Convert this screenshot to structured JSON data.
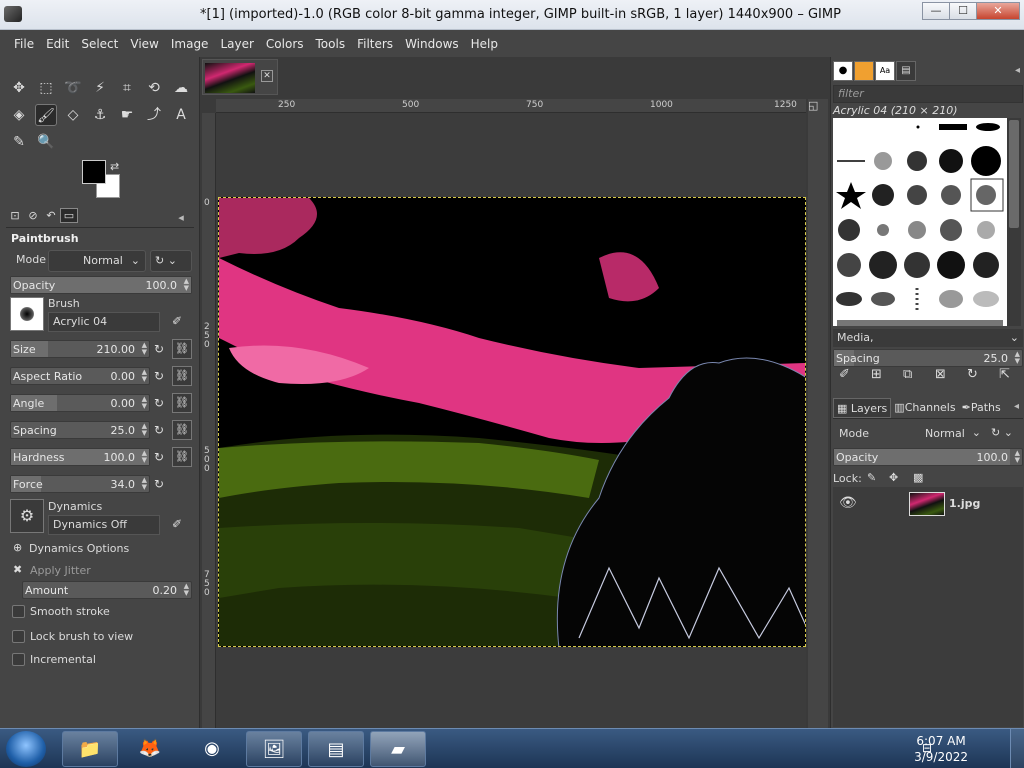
{
  "window": {
    "title": "*[1] (imported)-1.0 (RGB color 8-bit gamma integer, GIMP built-in sRGB, 1 layer) 1440x900 – GIMP",
    "min": "—",
    "max": "☐",
    "close": "✕"
  },
  "menu": [
    "File",
    "Edit",
    "Select",
    "View",
    "Image",
    "Layer",
    "Colors",
    "Tools",
    "Filters",
    "Windows",
    "Help"
  ],
  "tool_options": {
    "heading": "Paintbrush",
    "mode_label": "Mode",
    "mode_value": "Normal",
    "opacity": {
      "label": "Opacity",
      "value": "100.0",
      "fraction": 1.0
    },
    "brush_label": "Brush",
    "brush_value": "Acrylic 04",
    "size": {
      "label": "Size",
      "value": "210.00",
      "fraction": 0.27
    },
    "aspect": {
      "label": "Aspect Ratio",
      "value": "0.00",
      "fraction": 0.0
    },
    "angle": {
      "label": "Angle",
      "value": "0.00",
      "fraction": 0.33
    },
    "spacing": {
      "label": "Spacing",
      "value": "25.0",
      "fraction": 0.0
    },
    "hardness": {
      "label": "Hardness",
      "value": "100.0",
      "fraction": 1.0
    },
    "force": {
      "label": "Force",
      "value": "34.0",
      "fraction": 0.22
    },
    "dynamics_label": "Dynamics",
    "dynamics_value": "Dynamics Off",
    "dynamics_options": "Dynamics Options",
    "apply_jitter": "Apply Jitter",
    "amount": {
      "label": "Amount",
      "value": "0.20",
      "fraction": 0.0
    },
    "smooth": "Smooth stroke",
    "lock": "Lock brush to view",
    "incremental": "Incremental"
  },
  "ruler": {
    "h": [
      "250",
      "500",
      "750",
      "1000",
      "1250"
    ],
    "v": [
      "0",
      "250",
      "500",
      "750"
    ]
  },
  "brushes": {
    "filter_placeholder": "filter",
    "selected": "Acrylic 04 (210 × 210)",
    "tag": "Media,",
    "spacing_label": "Spacing",
    "spacing_value": "25.0"
  },
  "layers": {
    "tabs": [
      "Layers",
      "Channels",
      "Paths"
    ],
    "mode_label": "Mode",
    "mode_value": "Normal",
    "opacity_label": "Opacity",
    "opacity_value": "100.0",
    "lock_label": "Lock:",
    "layer_name": "1.jpg"
  },
  "taskbar": {
    "time": "6:07 AM",
    "date": "3/9/2022"
  }
}
